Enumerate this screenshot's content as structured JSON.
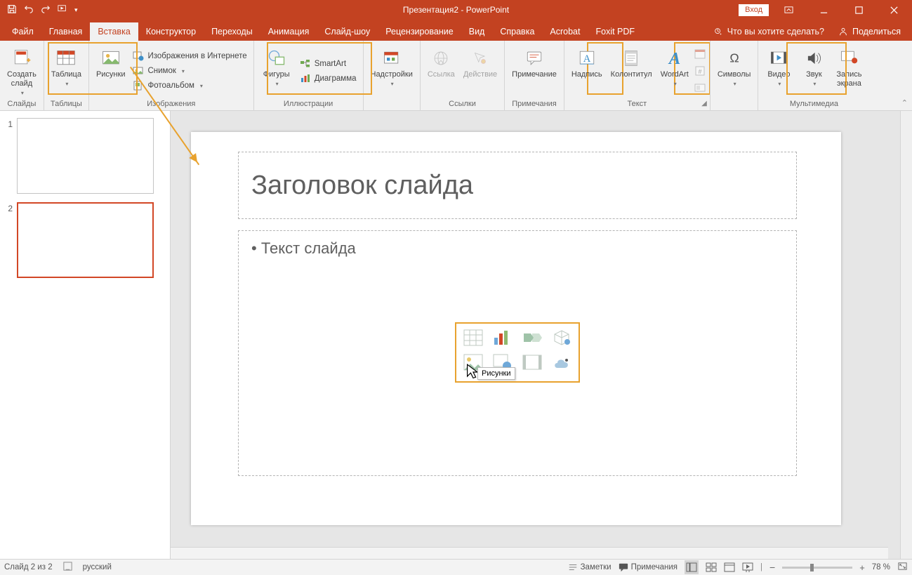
{
  "title": "Презентация2  -  PowerPoint",
  "login_btn": "Вход",
  "tell_me": "Что вы хотите сделать?",
  "share": "Поделиться",
  "tabs": [
    "Файл",
    "Главная",
    "Вставка",
    "Конструктор",
    "Переходы",
    "Анимация",
    "Слайд-шоу",
    "Рецензирование",
    "Вид",
    "Справка",
    "Acrobat",
    "Foxit PDF"
  ],
  "active_tab_index": 2,
  "ribbon": {
    "slides": {
      "new_slide": "Создать\nслайд",
      "group": "Слайды"
    },
    "tables": {
      "table": "Таблица",
      "group": "Таблицы"
    },
    "images": {
      "pictures": "Рисунки",
      "online": "Изображения в Интернете",
      "screenshot": "Снимок",
      "album": "Фотоальбом",
      "group": "Изображения"
    },
    "illus": {
      "shapes": "Фигуры",
      "smartart": "SmartArt",
      "chart": "Диаграмма",
      "group": "Иллюстрации"
    },
    "addins": {
      "addins": "Надстройки",
      "group": ""
    },
    "links": {
      "link": "Ссылка",
      "action": "Действие",
      "group": "Ссылки"
    },
    "comments": {
      "comment": "Примечание",
      "group": "Примечания"
    },
    "text": {
      "textbox": "Надпись",
      "headerfooter": "Колонтитул",
      "wordart": "WordArt",
      "group": "Текст"
    },
    "symbols": {
      "symbols": "Символы",
      "group": ""
    },
    "media": {
      "video": "Видео",
      "audio": "Звук",
      "screenrec": "Запись\nэкрана",
      "group": "Мультимедиа"
    }
  },
  "slide": {
    "title_placeholder": "Заголовок слайда",
    "content_placeholder": "Текст слайда",
    "tooltip": "Рисунки"
  },
  "thumbs": [
    1,
    2
  ],
  "selected_thumb": 2,
  "status": {
    "slide_info": "Слайд 2 из 2",
    "lang": "русский",
    "notes": "Заметки",
    "comments": "Примечания",
    "zoom": "78 %"
  }
}
